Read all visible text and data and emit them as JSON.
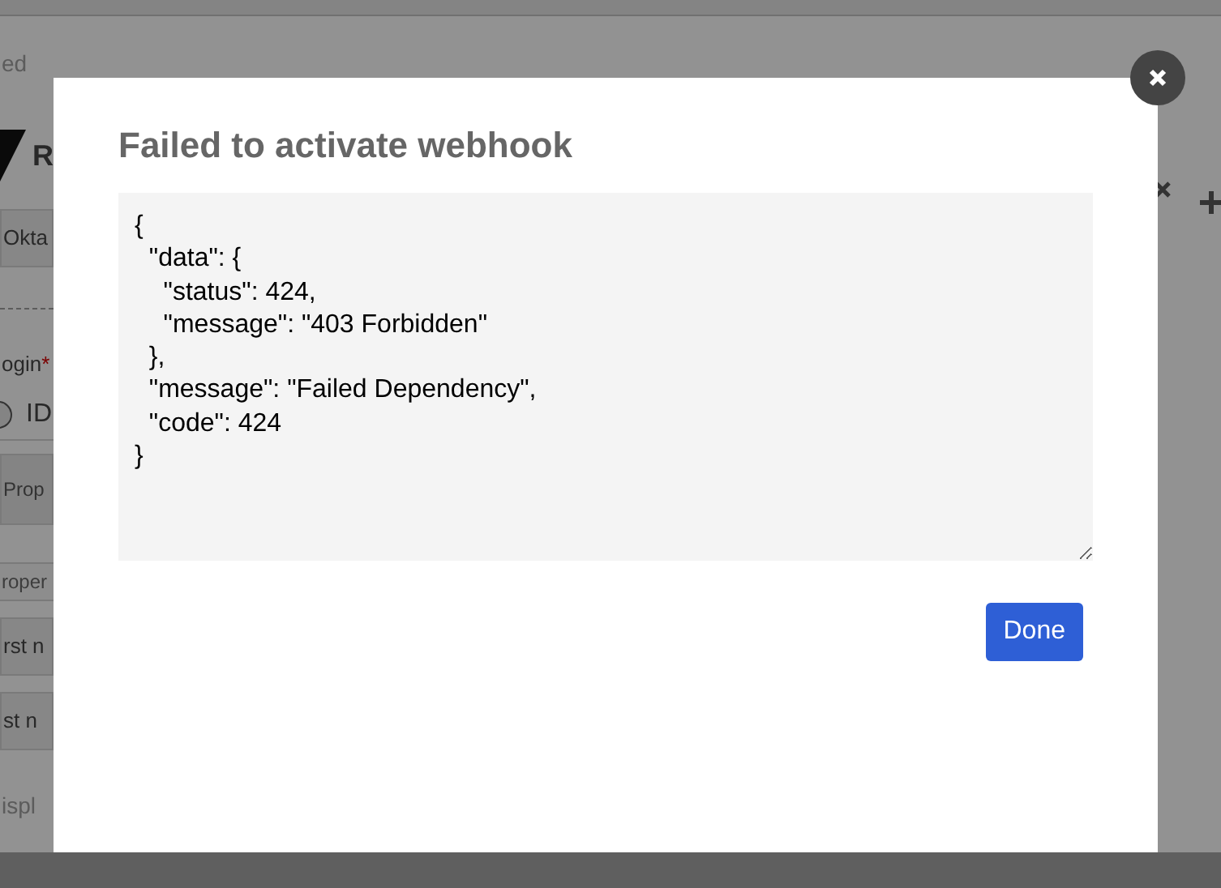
{
  "background": {
    "fragments": [
      {
        "kind": "text",
        "text": "ed"
      },
      {
        "kind": "logo",
        "text": "R"
      },
      {
        "kind": "field",
        "text": "Okta"
      },
      {
        "kind": "divider"
      },
      {
        "kind": "required_label",
        "text": "ogin",
        "mark": "*"
      },
      {
        "kind": "radio",
        "text": "ID"
      },
      {
        "kind": "button",
        "text": "Prop"
      },
      {
        "kind": "header",
        "text": "roper"
      },
      {
        "kind": "field",
        "text": "rst n"
      },
      {
        "kind": "field",
        "text": "st n"
      },
      {
        "kind": "text",
        "text": "ispl"
      }
    ]
  },
  "dialog": {
    "title": "Failed to activate webhook",
    "response": "{\n  \"data\": {\n    \"status\": 424,\n    \"message\": \"403 Forbidden\"\n  },\n  \"message\": \"Failed Dependency\",\n  \"code\": 424\n}",
    "button": "Done"
  }
}
